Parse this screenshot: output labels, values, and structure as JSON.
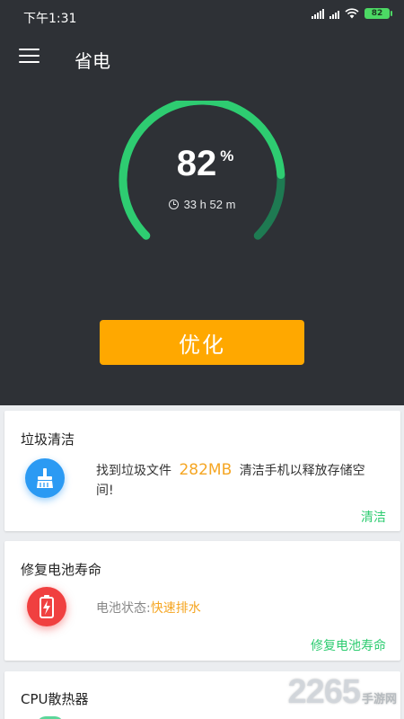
{
  "status_bar": {
    "time": "下午1:31",
    "battery_level": "82"
  },
  "toolbar": {
    "title": "省电",
    "menu_icon": "hamburger-menu-icon"
  },
  "battery": {
    "percent": "82",
    "percent_sign": "%",
    "level_fraction": 0.82,
    "time_remaining": "33 h 52 m",
    "arc_color": "#2ecc71",
    "arc_dark_color": "#1e7a52"
  },
  "optimize_button": {
    "label": "优化",
    "color": "#ffa800"
  },
  "cards": {
    "junk": {
      "title": "垃圾清洁",
      "icon": "broom-icon",
      "desc_prefix": "找到垃圾文件",
      "size": "282MB",
      "desc_suffix": "清洁手机以释放存储空间!",
      "action": "清洁"
    },
    "battery_repair": {
      "title": "修复电池寿命",
      "icon": "battery-charging-icon",
      "status_label": "电池状态:",
      "status_value": "快速排水",
      "action": "修复电池寿命"
    },
    "cpu": {
      "title": "CPU散热器"
    }
  },
  "watermark": {
    "main": "2265",
    "sub": "手游网"
  }
}
